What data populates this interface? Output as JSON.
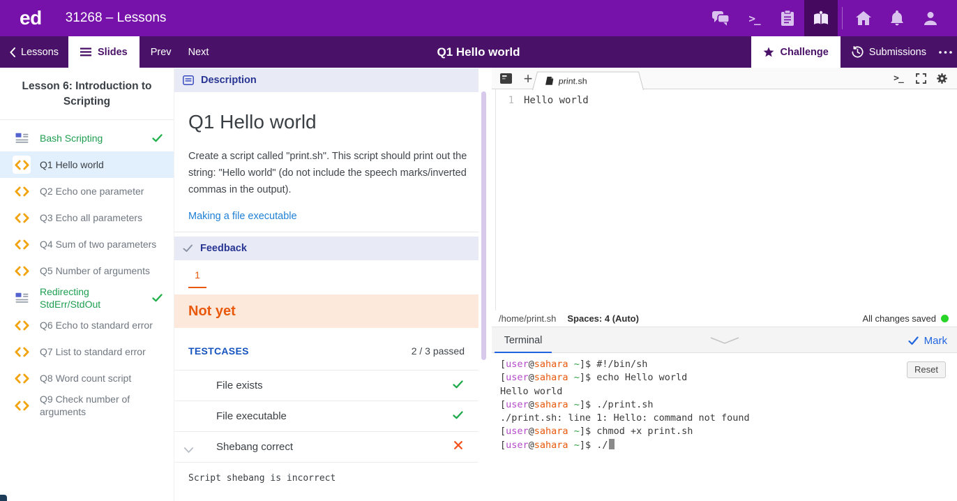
{
  "topbar": {
    "logo": "ed",
    "title": "31268 – Lessons",
    "terminal_icon_glyph": ">_",
    "icons": [
      "discussion-icon",
      "workspaces-terminal-icon",
      "assessments-icon",
      "lessons-book-icon",
      "home-icon",
      "notifications-bell-icon",
      "account-user-icon"
    ],
    "active_icon": "lessons-book-icon",
    "colors": {
      "bar": "#7612a9",
      "active_tile": "#45095f",
      "icon": "#d9c2ee"
    }
  },
  "navbar": {
    "back_label": "Lessons",
    "slides_label": "Slides",
    "prev_label": "Prev",
    "next_label": "Next",
    "title": "Q1 Hello world",
    "challenge_label": "Challenge",
    "submissions_label": "Submissions",
    "icons": [
      "chevron-left-icon",
      "hamburger-icon",
      "star-icon",
      "history-icon",
      "ellipsis-icon"
    ],
    "colors": {
      "bar": "#4a1168",
      "active_tab_bg": "#ffffff"
    }
  },
  "sidebar": {
    "heading": "Lesson 6: Introduction to Scripting",
    "items": [
      {
        "label": "Bash Scripting",
        "type": "slide",
        "completed": true,
        "selected": false
      },
      {
        "label": "Q1 Hello world",
        "type": "code",
        "completed": false,
        "selected": true
      },
      {
        "label": "Q2 Echo one parameter",
        "type": "code",
        "completed": false,
        "selected": false
      },
      {
        "label": "Q3 Echo all parameters",
        "type": "code",
        "completed": false,
        "selected": false
      },
      {
        "label": "Q4 Sum of two parameters",
        "type": "code",
        "completed": false,
        "selected": false
      },
      {
        "label": "Q5 Number of arguments",
        "type": "code",
        "completed": false,
        "selected": false
      },
      {
        "label": "Redirecting StdErr/StdOut",
        "type": "slide",
        "completed": true,
        "selected": false
      },
      {
        "label": "Q6 Echo to standard error",
        "type": "code",
        "completed": false,
        "selected": false
      },
      {
        "label": "Q7 List to standard error",
        "type": "code",
        "completed": false,
        "selected": false
      },
      {
        "label": "Q8 Word count script",
        "type": "code",
        "completed": false,
        "selected": false
      },
      {
        "label": "Q9 Check number of arguments",
        "type": "code",
        "completed": false,
        "selected": false
      }
    ],
    "colors": {
      "selected_bg": "#e2f0fd",
      "completed_text": "#1e9e50",
      "code_icon": "#f2a410",
      "check": "#21b14c"
    }
  },
  "description": {
    "header_label": "Description",
    "title": "Q1 Hello world",
    "body": "Create a script called \"print.sh\". This script should print out the string: \"Hello world\" (do not include the speech marks/inverted commas in the output).",
    "link_label": "Making a file executable",
    "colors": {
      "header_bg": "#e8eaf6",
      "header_text": "#283593",
      "link": "#1e7fd6"
    }
  },
  "feedback": {
    "header_label": "Feedback",
    "attempt_tab": "1",
    "status": "Not yet",
    "testcases_label": "TESTCASES",
    "passed_summary": "2 / 3 passed",
    "testcases": [
      {
        "name": "File exists",
        "passed": true
      },
      {
        "name": "File executable",
        "passed": true
      },
      {
        "name": "Shebang correct",
        "passed": false,
        "expanded": true,
        "detail": "Script shebang is incorrect"
      }
    ],
    "colors": {
      "status_bg": "#fce9db",
      "status_text": "#e8590c",
      "testcases_label": "#1553be",
      "pass": "#21a94d",
      "fail": "#f4511e"
    }
  },
  "editor": {
    "tab_name": "print.sh",
    "new_file_glyph": "+",
    "terminal_icon_glyph": ">_",
    "line_number": "1",
    "code": "Hello world",
    "path": "/home/print.sh",
    "indent_label": "Spaces: 4 (Auto)",
    "saved_label": "All changes saved",
    "icons": [
      "file-explorer-icon",
      "new-file-icon",
      "file-icon",
      "open-terminal-icon",
      "fullscreen-icon",
      "settings-gear-icon"
    ],
    "colors": {
      "saved_dot": "#28d428"
    }
  },
  "terminal": {
    "tab_label": "Terminal",
    "mark_label": "Mark",
    "reset_label": "Reset",
    "prompt": {
      "bracket_open": "[",
      "user": "user",
      "at": "@",
      "host": "sahara",
      "path": " ~",
      "bracket_close": "]$ "
    },
    "lines": [
      {
        "type": "cmd",
        "text": "#!/bin/sh"
      },
      {
        "type": "cmd",
        "text": "echo Hello world"
      },
      {
        "type": "out",
        "text": "Hello world"
      },
      {
        "type": "cmd",
        "text": "./print.sh"
      },
      {
        "type": "out",
        "text": "./print.sh: line 1: Hello: command not found"
      },
      {
        "type": "cmd",
        "text": "chmod +x print.sh"
      },
      {
        "type": "cmd",
        "text": "./",
        "cursor": true
      }
    ],
    "colors": {
      "user": "#b44bc9",
      "host": "#e8590c",
      "tilde": "#2ea043",
      "text": "#3a3a3a",
      "mark_blue": "#2166e0"
    }
  }
}
